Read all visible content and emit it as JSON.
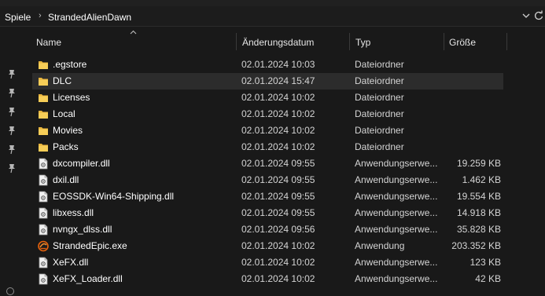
{
  "breadcrumb": {
    "items": [
      "Spiele",
      "StrandedAlienDawn"
    ]
  },
  "columns": {
    "name": "Name",
    "date": "Änderungsdatum",
    "type": "Typ",
    "size": "Größe"
  },
  "files": [
    {
      "name": ".egstore",
      "date": "02.01.2024 10:03",
      "type": "Dateiordner",
      "size": "",
      "icon": "folder-icon"
    },
    {
      "name": "DLC",
      "date": "02.01.2024 15:47",
      "type": "Dateiordner",
      "size": "",
      "icon": "folder-icon",
      "selected": true
    },
    {
      "name": "Licenses",
      "date": "02.01.2024 10:02",
      "type": "Dateiordner",
      "size": "",
      "icon": "folder-icon"
    },
    {
      "name": "Local",
      "date": "02.01.2024 10:02",
      "type": "Dateiordner",
      "size": "",
      "icon": "folder-icon"
    },
    {
      "name": "Movies",
      "date": "02.01.2024 10:02",
      "type": "Dateiordner",
      "size": "",
      "icon": "folder-icon"
    },
    {
      "name": "Packs",
      "date": "02.01.2024 10:02",
      "type": "Dateiordner",
      "size": "",
      "icon": "folder-icon"
    },
    {
      "name": "dxcompiler.dll",
      "date": "02.01.2024 09:55",
      "type": "Anwendungserwe...",
      "size": "19.259 KB",
      "icon": "dll-file-icon"
    },
    {
      "name": "dxil.dll",
      "date": "02.01.2024 09:55",
      "type": "Anwendungserwe...",
      "size": "1.462 KB",
      "icon": "dll-file-icon"
    },
    {
      "name": "EOSSDK-Win64-Shipping.dll",
      "date": "02.01.2024 09:55",
      "type": "Anwendungserwe...",
      "size": "19.554 KB",
      "icon": "dll-file-icon"
    },
    {
      "name": "libxess.dll",
      "date": "02.01.2024 09:55",
      "type": "Anwendungserwe...",
      "size": "14.918 KB",
      "icon": "dll-file-icon"
    },
    {
      "name": "nvngx_dlss.dll",
      "date": "02.01.2024 09:56",
      "type": "Anwendungserwe...",
      "size": "35.828 KB",
      "icon": "dll-file-icon"
    },
    {
      "name": "StrandedEpic.exe",
      "date": "02.01.2024 10:02",
      "type": "Anwendung",
      "size": "203.352 KB",
      "icon": "app-exe-icon"
    },
    {
      "name": "XeFX.dll",
      "date": "02.01.2024 10:02",
      "type": "Anwendungserwe...",
      "size": "123 KB",
      "icon": "dll-file-icon"
    },
    {
      "name": "XeFX_Loader.dll",
      "date": "02.01.2024 10:02",
      "type": "Anwendungserwe...",
      "size": "42 KB",
      "icon": "dll-file-icon"
    }
  ],
  "quick_access_pins": 6,
  "colors": {
    "background": "#191919",
    "selected_row": "#2c2c2c",
    "folder": "#f0c24b",
    "exe_icon": "#e8620c"
  }
}
